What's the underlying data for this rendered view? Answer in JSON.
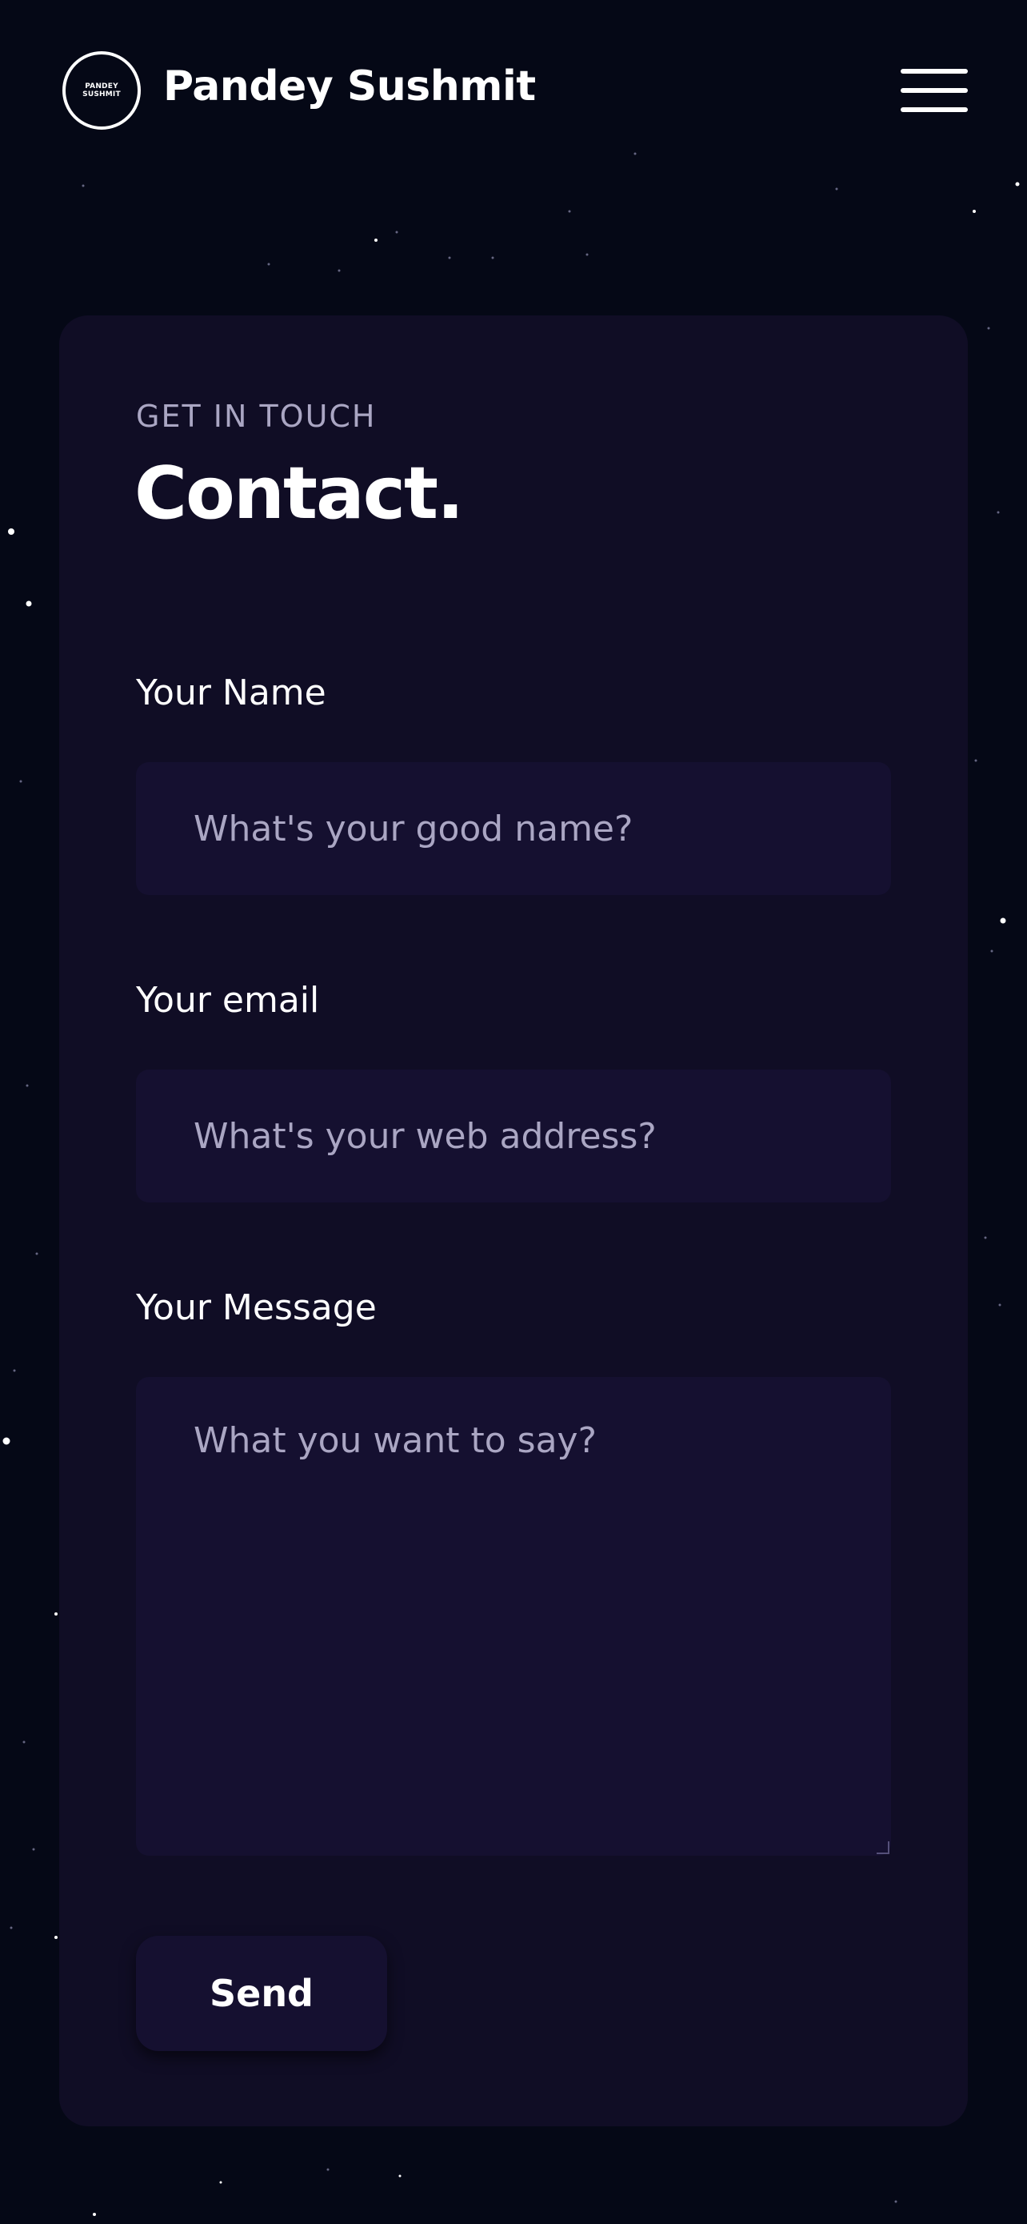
{
  "header": {
    "logo_line1": "PANDEY",
    "logo_line2": "SUSHMIT",
    "brand_name": "Pandey Sushmit"
  },
  "contact": {
    "subtitle": "GET IN TOUCH",
    "title": "Contact.",
    "name_label": "Your Name",
    "name_placeholder": "What's your good name?",
    "email_label": "Your email",
    "email_placeholder": "What's your web address?",
    "message_label": "Your Message",
    "message_placeholder": "What you want to say?",
    "send_label": "Send"
  },
  "colors": {
    "background": "#050816",
    "card": "#100d25",
    "input": "#151030",
    "placeholder": "#aaa6c3",
    "text": "#ffffff"
  },
  "icons": {
    "menu": "hamburger-menu-icon"
  }
}
